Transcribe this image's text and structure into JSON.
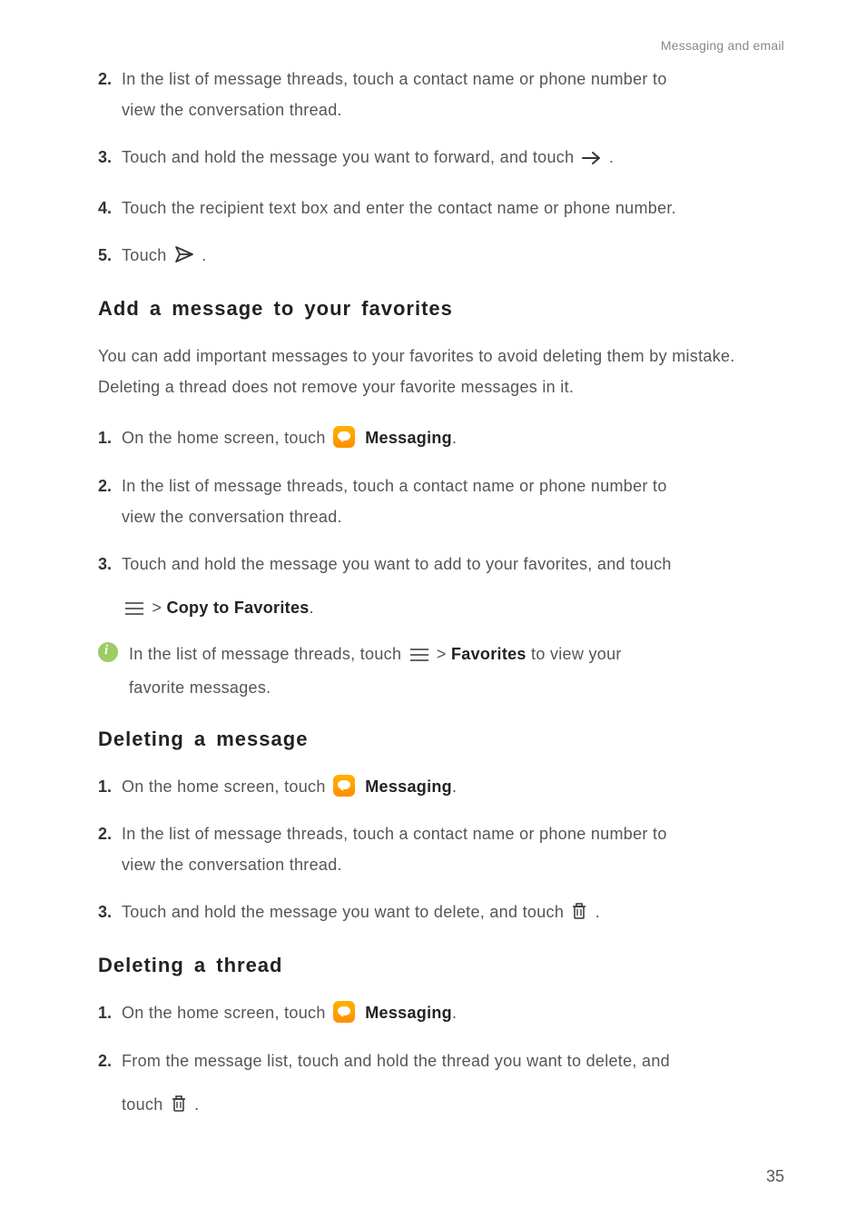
{
  "header": {
    "section_label": "Messaging and email"
  },
  "top_steps": {
    "s2": {
      "num": "2.",
      "line1": "In the list of message threads, touch a contact name or phone number to",
      "line2": "view the conversation thread."
    },
    "s3": {
      "num": "3.",
      "text_before": "Touch and hold the message you want to forward, and touch ",
      "text_after": "."
    },
    "s4": {
      "num": "4.",
      "text": "Touch the recipient text box and enter the contact name or phone number."
    },
    "s5": {
      "num": "5.",
      "text_before": "Touch ",
      "text_after": "."
    }
  },
  "favorites": {
    "heading": "Add a message to your favorites",
    "intro": "You can add important messages to your favorites to avoid deleting them by mistake. Deleting a thread does not remove your favorite messages in it.",
    "s1": {
      "num": "1.",
      "before": "On the home screen, touch ",
      "after_bold": "Messaging",
      "dot": "."
    },
    "s2": {
      "num": "2.",
      "line1": "In the list of message threads, touch a contact name or phone number to",
      "line2": "view the conversation thread."
    },
    "s3": {
      "num": "3.",
      "line1": "Touch and hold the message you want to add to your favorites, and touch",
      "line2_before": " > ",
      "line2_bold": "Copy to Favorites",
      "line2_after": "."
    },
    "note": {
      "before": "In the list of message threads, touch ",
      "mid": " > ",
      "bold": "Favorites",
      "after": " to view your",
      "line2": "favorite messages."
    }
  },
  "delete_msg": {
    "heading": "Deleting a message",
    "s1": {
      "num": "1.",
      "before": "On the home screen, touch ",
      "after_bold": "Messaging",
      "dot": "."
    },
    "s2": {
      "num": "2.",
      "line1": "In the list of message threads, touch a contact name or phone number to",
      "line2": "view the conversation thread."
    },
    "s3": {
      "num": "3.",
      "before": "Touch and hold the message you want to delete, and touch ",
      "after": " ."
    }
  },
  "delete_thread": {
    "heading": "Deleting a thread",
    "s1": {
      "num": "1.",
      "before": "On the home screen, touch ",
      "after_bold": "Messaging",
      "dot": "."
    },
    "s2": {
      "num": "2.",
      "line1": "From the message list, touch and hold the thread you want to delete, and",
      "line2_before": "touch ",
      "line2_after": " ."
    }
  },
  "page_number": "35"
}
